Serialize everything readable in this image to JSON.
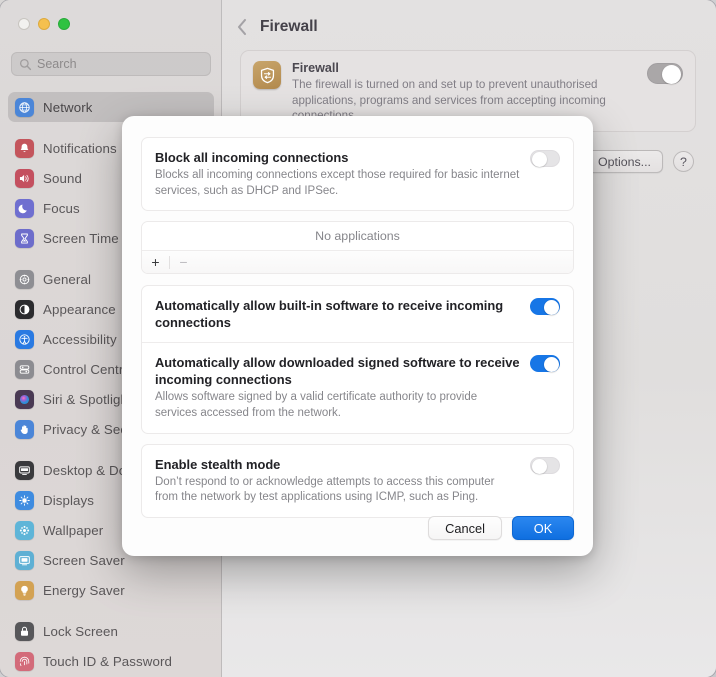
{
  "window": {
    "traffic_lights": [
      "close",
      "minimise",
      "maximise"
    ]
  },
  "sidebar": {
    "search": {
      "placeholder": "Search",
      "value": "",
      "icon": "search-icon"
    },
    "items": [
      {
        "label": "Network",
        "icon": "globe-icon",
        "color": "#4b86d8",
        "selected": true,
        "gap_after": true
      },
      {
        "label": "Notifications",
        "icon": "bell-icon",
        "color": "#c4555c",
        "selected": false,
        "gap_after": false
      },
      {
        "label": "Sound",
        "icon": "speaker-icon",
        "color": "#c4505f",
        "selected": false,
        "gap_after": false
      },
      {
        "label": "Focus",
        "icon": "moon-icon",
        "color": "#6f6fd0",
        "selected": false,
        "gap_after": false
      },
      {
        "label": "Screen Time",
        "icon": "hourglass-icon",
        "color": "#6d6dcb",
        "selected": false,
        "gap_after": true
      },
      {
        "label": "General",
        "icon": "gear-icon",
        "color": "#8e8e93",
        "selected": false,
        "gap_after": false
      },
      {
        "label": "Appearance",
        "icon": "contrast-icon",
        "color": "#2b2b2e",
        "selected": false,
        "gap_after": false
      },
      {
        "label": "Accessibility",
        "icon": "accessibility-icon",
        "color": "#2a7ae2",
        "selected": false,
        "gap_after": false
      },
      {
        "label": "Control Centre",
        "icon": "sliders-icon",
        "color": "#8c8c91",
        "selected": false,
        "gap_after": false
      },
      {
        "label": "Siri & Spotlight",
        "icon": "siri-icon",
        "color": "#4a3a54",
        "selected": false,
        "gap_after": false
      },
      {
        "label": "Privacy & Security",
        "icon": "hand-icon",
        "color": "#4b86d8",
        "selected": false,
        "gap_after": true
      },
      {
        "label": "Desktop & Dock",
        "icon": "desktop-icon",
        "color": "#3a3a3d",
        "selected": false,
        "gap_after": false
      },
      {
        "label": "Displays",
        "icon": "sun-icon",
        "color": "#3f8ce0",
        "selected": false,
        "gap_after": false
      },
      {
        "label": "Wallpaper",
        "icon": "wallpaper-icon",
        "color": "#5fb5d8",
        "selected": false,
        "gap_after": false
      },
      {
        "label": "Screen Saver",
        "icon": "screensaver-icon",
        "color": "#5fb0d4",
        "selected": false,
        "gap_after": false
      },
      {
        "label": "Energy Saver",
        "icon": "bulb-icon",
        "color": "#d3a253",
        "selected": false,
        "gap_after": true
      },
      {
        "label": "Lock Screen",
        "icon": "lock-icon",
        "color": "#57575a",
        "selected": false,
        "gap_after": false
      },
      {
        "label": "Touch ID & Password",
        "icon": "fingerprint-icon",
        "color": "#d36b7a",
        "selected": false,
        "gap_after": false
      }
    ]
  },
  "detail": {
    "back_icon": "chevron-left-icon",
    "title": "Firewall",
    "card": {
      "icon": "firewall-icon",
      "title": "Firewall",
      "description": "The firewall is turned on and set up to prevent unauthorised applications, programs and services from accepting incoming connections.",
      "toggle_on": false
    },
    "options_button": "Options...",
    "help_button": "?"
  },
  "sheet": {
    "block_all": {
      "title": "Block all incoming connections",
      "description": "Blocks all incoming connections except those required for basic internet services, such as DHCP and IPSec.",
      "toggle_on": false
    },
    "apps": {
      "empty_label": "No applications",
      "add_label": "+",
      "remove_label": "−"
    },
    "builtin": {
      "title": "Automatically allow built-in software to receive incoming connections",
      "description": "",
      "toggle_on": true
    },
    "signed": {
      "title": "Automatically allow downloaded signed software to receive incoming connections",
      "description": "Allows software signed by a valid certificate authority to provide services accessed from the network.",
      "toggle_on": true
    },
    "stealth": {
      "title": "Enable stealth mode",
      "description": "Don’t respond to or acknowledge attempts to access this computer from the network by test applications using ICMP, such as Ping.",
      "toggle_on": false
    },
    "cancel_label": "Cancel",
    "ok_label": "OK"
  },
  "colors": {
    "accent": "#1776e6",
    "ok_button": "#0f6fe0",
    "selected_row": "#b2afb0"
  }
}
